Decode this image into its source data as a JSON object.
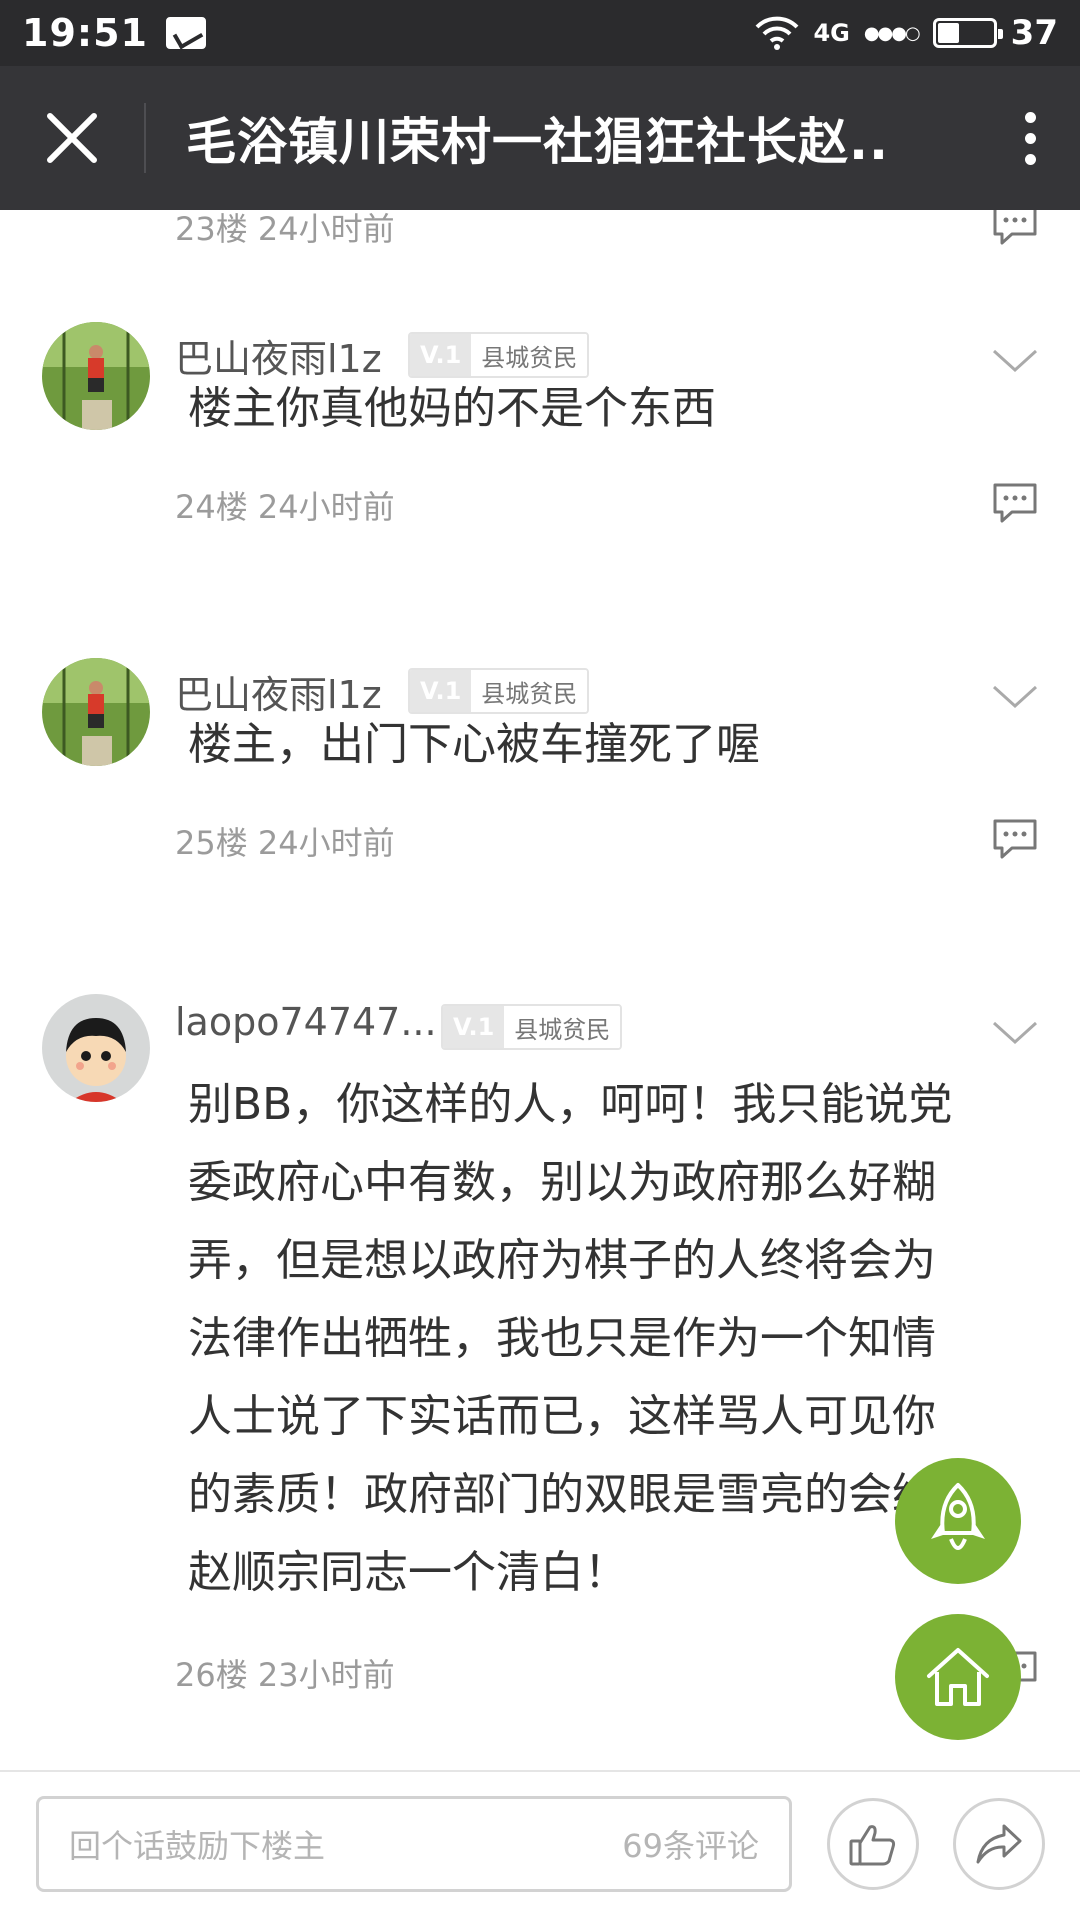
{
  "status": {
    "time": "19:51",
    "network": "4G",
    "battery": "37"
  },
  "appbar": {
    "title": "毛浴镇川荣村一社猖狂社长赵.."
  },
  "top_meta": {
    "floor": "23楼",
    "time": "24小时前"
  },
  "comments": [
    {
      "user": "巴山夜雨l1z",
      "level": "V.1",
      "rank": "县城贫民",
      "text": "楼主你真他妈的不是个东西",
      "floor": "24楼",
      "time": "24小时前"
    },
    {
      "user": "巴山夜雨l1z",
      "level": "V.1",
      "rank": "县城贫民",
      "text": "楼主，出门下心被车撞死了喔",
      "floor": "25楼",
      "time": "24小时前"
    },
    {
      "user": "laopo74747...",
      "level": "V.1",
      "rank": "县城贫民",
      "lines": [
        "别BB，你这样的人，呵呵！我只能说党",
        "委政府心中有数，别以为政府那么好糊",
        "弄，但是想以政府为棋子的人终将会为",
        "法律作出牺牲，我也只是作为一个知情",
        "人士说了下实话而已，这样骂人可见你",
        "的素质！政府部门的双眼是雪亮的会给",
        "赵顺宗同志一个清白！"
      ],
      "floor": "26楼",
      "time": "23小时前"
    }
  ],
  "bottom": {
    "placeholder": "回个话鼓励下楼主",
    "count": "69条评论"
  },
  "colors": {
    "accent": "#7cb234",
    "appbar": "#353538",
    "statusbar": "#2b2b2d"
  },
  "icons": [
    "close-icon",
    "more-icon",
    "reply-icon",
    "chevron-down-icon",
    "rocket-icon",
    "home-icon",
    "thumbs-up-icon",
    "share-icon"
  ]
}
